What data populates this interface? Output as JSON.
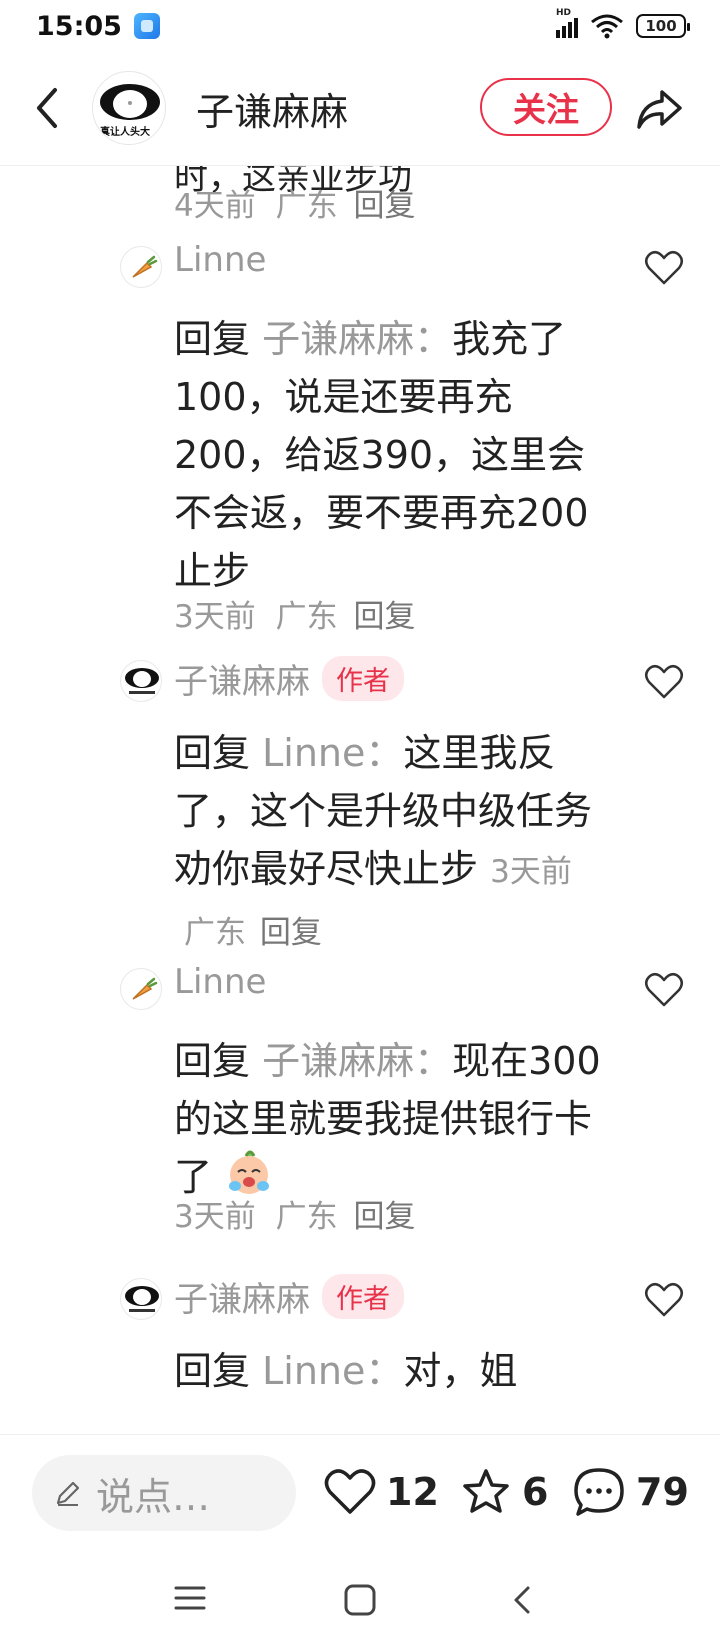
{
  "status_bar": {
    "time": "15:05",
    "network": "HD",
    "battery": "100"
  },
  "header": {
    "back_icon": "chevron-left-icon",
    "avatar_caption": "真让人头大",
    "title": "子谦麻麻",
    "follow_label": "关注",
    "share_icon": "share-icon"
  },
  "feed": {
    "cut_text": "时，这亲亚步功",
    "cut_meta": {
      "time": "4天前",
      "location": "广东",
      "reply": "回复"
    },
    "comments": [
      {
        "user": "Linne",
        "is_author": false,
        "reply_prefix": "回复",
        "reply_target": "子谦麻麻：",
        "text": "我充了100，说是还要再充200，给返390，这里会不会返，要不要再充200止步",
        "time": "3天前",
        "location": "广东",
        "reply": "回复"
      },
      {
        "user": "子谦麻麻",
        "is_author": true,
        "author_badge": "作者",
        "reply_prefix": "回复",
        "reply_target": "Linne：",
        "text": "这里我反了，这个是升级中级任务劝你最好尽快止步",
        "time": "3天前",
        "location": "广东",
        "reply": "回复"
      },
      {
        "user": "Linne",
        "is_author": false,
        "reply_prefix": "回复",
        "reply_target": "子谦麻麻：",
        "text": "现在300的这里就要我提供银行卡了",
        "emoji": "crying-face-emoji",
        "time": "3天前",
        "location": "广东",
        "reply": "回复"
      },
      {
        "user": "子谦麻麻",
        "is_author": true,
        "author_badge": "作者",
        "reply_prefix": "回复",
        "reply_target": "Linne：",
        "text": "对，姐"
      }
    ]
  },
  "bottom_bar": {
    "input_placeholder": "说点…",
    "likes": "12",
    "favorites": "6",
    "comments": "79"
  },
  "colors": {
    "accent": "#e8324a",
    "muted_text": "#999999",
    "badge_bg": "#fde7ea"
  }
}
